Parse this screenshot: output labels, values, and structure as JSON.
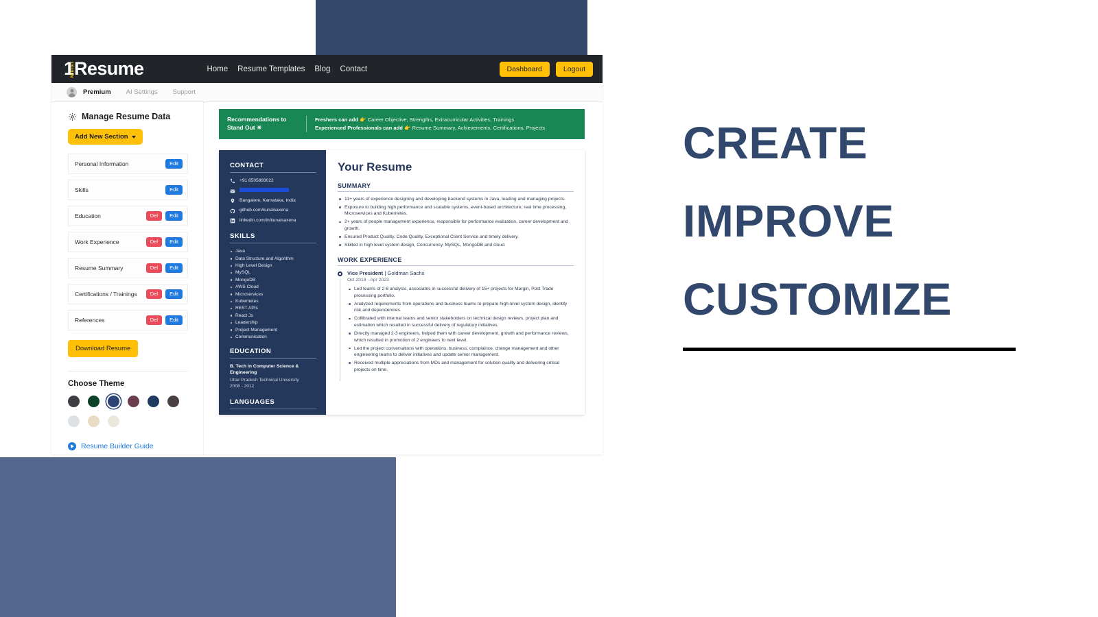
{
  "background": {
    "block_top_color": "#354a6b",
    "block_bottom_color": "#53688c"
  },
  "topnav": {
    "brand_one": "1",
    "brand_million": "Million",
    "brand_resume": "Resume",
    "links": [
      "Home",
      "Resume Templates",
      "Blog",
      "Contact"
    ],
    "dashboard_label": "Dashboard",
    "logout_label": "Logout",
    "accent_color": "#ffc107"
  },
  "subnav": {
    "avatar": "user-avatar",
    "items": [
      {
        "label": "Premium",
        "active": true
      },
      {
        "label": "AI Settings",
        "active": false
      },
      {
        "label": "Support",
        "active": false
      }
    ]
  },
  "left_panel": {
    "gear_icon": "gear-icon",
    "title": "Manage Resume Data",
    "add_section_label": "Add New Section",
    "sections": [
      {
        "label": "Personal Information",
        "del": false,
        "edit": "Edit"
      },
      {
        "label": "Skills",
        "del": false,
        "edit": "Edit"
      },
      {
        "label": "Education",
        "del": "Del",
        "edit": "Edit"
      },
      {
        "label": "Work Experience",
        "del": "Del",
        "edit": "Edit"
      },
      {
        "label": "Resume Summary",
        "del": "Del",
        "edit": "Edit"
      },
      {
        "label": "Certifications / Trainings",
        "del": "Del",
        "edit": "Edit"
      },
      {
        "label": "References",
        "del": "Del",
        "edit": "Edit"
      }
    ],
    "download_label": "Download Resume",
    "theme_title": "Choose Theme",
    "themes": [
      {
        "color": "#3e3e42",
        "selected": false
      },
      {
        "color": "#0b4229",
        "selected": false
      },
      {
        "color": "#2c4373",
        "selected": true
      },
      {
        "color": "#6b3f50",
        "selected": false
      },
      {
        "color": "#1e3a5f",
        "selected": false
      },
      {
        "color": "#4a3f42",
        "selected": false
      },
      {
        "color": "#dde1e6",
        "selected": false
      },
      {
        "color": "#e8dcc4",
        "selected": false
      },
      {
        "color": "#ece7dc",
        "selected": false
      }
    ],
    "guide_label": "Resume Builder Guide"
  },
  "banner": {
    "heading": "Recommendations to Stand Out ☀",
    "freshers_label": "Freshers can add",
    "freshers_emoji": "👉",
    "freshers_text": "Career Objective, Strengths, Extracurricular Activities, Trainings",
    "experienced_label": "Experienced Professionals can add",
    "experienced_emoji": "👉",
    "experienced_text": "Resume Summary, Achievements, Certifications, Projects",
    "color": "#198754"
  },
  "resume": {
    "title": "Your Resume",
    "sidebar": {
      "contact_heading": "CONTACT",
      "contacts": [
        {
          "icon": "phone-icon",
          "text": "+91 8505893022",
          "redacted": false
        },
        {
          "icon": "email-icon",
          "text": "",
          "redacted": true
        },
        {
          "icon": "location-pin-icon",
          "text": "Bangalore, Karnataka, India",
          "redacted": false
        },
        {
          "icon": "github-icon",
          "text": "github.com/kunalsaxena",
          "redacted": false
        },
        {
          "icon": "linkedin-icon",
          "text": "linkedin.com/in/kunalsaxena",
          "redacted": false
        }
      ],
      "skills_heading": "SKILLS",
      "skills": [
        "Java",
        "Data Structure and Algorithm",
        "High Level Design",
        "MySQL",
        "MongoDB",
        "AWS Cloud",
        "Microservices",
        "Kubernetes",
        "REST APIs",
        "React Js",
        "Leadership",
        "Project Management",
        "Communication"
      ],
      "education_heading": "EDUCATION",
      "education_degree": "B. Tech in Computer Science & Engineering",
      "education_school": "Uttar Pradesh Technical University",
      "education_years": "2008 - 2012",
      "languages_heading": "LANGUAGES"
    },
    "summary_heading": "SUMMARY",
    "summary_points": [
      "11+ years of experience designing and developing backend systems in Java, leading and managing projects.",
      "Exposure to building high performance and scalable systems, event-based architecture, real time processing, Microservices and Kubernetes.",
      "2+ years of people management experience, responsible for performance evaluation, career development and growth.",
      "Ensured Product Quality, Code Quality, Exceptional Client Service and timely delivery.",
      "Skilled in high level system design, Concurrency, MySQL, MongoDB and cloud."
    ],
    "work_heading": "WORK EXPERIENCE",
    "job_role": "Vice President",
    "job_company": "Goldman Sachs",
    "job_dates": "Oct 2018 - Apr 2023",
    "job_points": [
      "Led teams of 2-6 analysis, associates in successful delivery of 15+ projects for Margin, Post Trade processing portfolio.",
      "Analyzed requirements from operations and business teams to prepare high-level system design, identify risk and dependencies.",
      "Collibrated with internal teams and senior stakeholders on technical design reviews, project plan and estimation which resulted in successful delivery of regulatory initiatives.",
      "Directly managed 2-3 engineers, helped them with career development, growth and performance reviews, which resulted in promotion of 2 engineers to next level.",
      "Led the project conversations with operations, business, complaince, change management and other engineering teams to deliver initiatives and update senior management.",
      "Received multiple appreciations from MDs and management for solution quality and delivering critical projects on time."
    ]
  },
  "promo": {
    "line1": "CREATE",
    "line2": "IMPROVE",
    "line3": "CUSTOMIZE",
    "text_color": "#31486c",
    "rule_color": "#000000"
  }
}
